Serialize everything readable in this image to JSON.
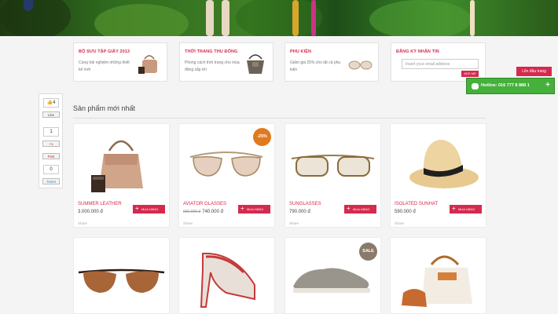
{
  "promos": [
    {
      "title": "BỘ SƯU TẬP GIẦY 2013",
      "text": "Cùng trải nghiệm những thiết kế mới"
    },
    {
      "title": "THỜI TRANG THU ĐÔNG",
      "text": "Phong cách thời trang cho mùa đông sắp tới"
    },
    {
      "title": "PHỤ KIỆN",
      "text": "Giảm giá 25% cho tất cả phụ kiện"
    },
    {
      "title": "ĐĂNG KÝ NHẬN TIN",
      "placeholder": "Insert your email address",
      "button": "ADD ME"
    }
  ],
  "social": {
    "like_count": "4",
    "like_label": "Like",
    "gplus_count": "1",
    "gplus_label": "+1",
    "pinit_label": "Pinit",
    "tweet_count": "0",
    "tweet_label": "Tweet"
  },
  "top_button": "Lên đầu trang",
  "hotline": "Hotline: 016 777 8 888 1",
  "section_title": "Sản phẩm mới nhất",
  "products": [
    {
      "name": "SUMMER LEATHER",
      "price": "3.000.000 đ",
      "old_price": "",
      "buy": "MUA HÀNG",
      "share": "Share",
      "badge": ""
    },
    {
      "name": "AVIATOR GLASSES",
      "price": "740.000 đ",
      "old_price": "990.000 đ",
      "buy": "MUA HÀNG",
      "share": "Share",
      "badge": "-25%"
    },
    {
      "name": "SUNGLASSES",
      "price": "790.000 đ",
      "old_price": "",
      "buy": "MUA HÀNG",
      "share": "Share",
      "badge": ""
    },
    {
      "name": "ISOLATED SUNHAT",
      "price": "590.000 đ",
      "old_price": "",
      "buy": "MUA HÀNG",
      "share": "Share",
      "badge": ""
    },
    {
      "badge": ""
    },
    {
      "badge": ""
    },
    {
      "badge": "SALE"
    },
    {
      "badge": ""
    }
  ],
  "colors": {
    "accent": "#d6294e",
    "hotline": "#45b03a",
    "badge_orange": "#e07a20",
    "badge_sale": "#8a7a6a"
  }
}
